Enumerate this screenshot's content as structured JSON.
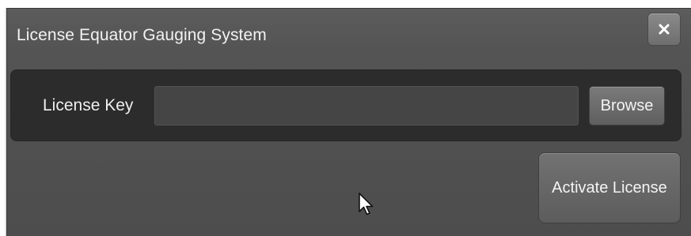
{
  "dialog": {
    "title": "License Equator Gauging System",
    "close_icon": "close-icon"
  },
  "form": {
    "license_key_label": "License Key",
    "license_key_value": "",
    "license_key_placeholder": "",
    "browse_label": "Browse"
  },
  "actions": {
    "activate_label": "Activate License"
  },
  "cursor": {
    "icon": "mouse-pointer-icon"
  },
  "colors": {
    "dialog_background": "#525252",
    "panel_background": "#2c2c2c",
    "text": "#f2f2f2"
  }
}
